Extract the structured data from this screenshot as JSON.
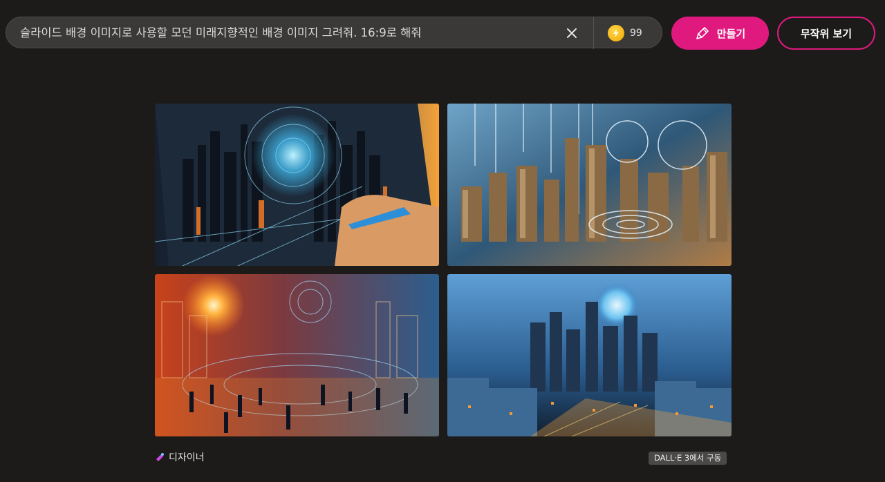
{
  "search": {
    "prompt_value": "슬라이드 배경 이미지로 사용할 모던 미래지향적인 배경 이미지 그려줘.  16:9로 해줘",
    "clear_icon": "close-icon",
    "boost_icon": "lightning-coin-icon",
    "boost_count": "99"
  },
  "actions": {
    "create_label": "만들기",
    "create_icon": "brush-icon",
    "random_label": "무작위 보기",
    "accent_color": "#e0197f"
  },
  "results": {
    "images": [
      {
        "name": "generated-image-1"
      },
      {
        "name": "generated-image-2"
      },
      {
        "name": "generated-image-3"
      },
      {
        "name": "generated-image-4"
      }
    ]
  },
  "footer": {
    "brand_label": "디자이너",
    "brand_icon": "designer-logo-icon",
    "powered_by": "DALL·E 3에서 구동"
  }
}
